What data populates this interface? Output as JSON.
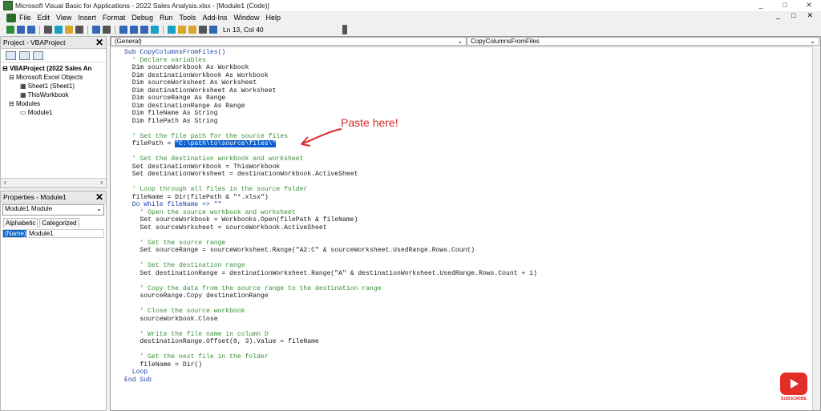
{
  "window": {
    "title": "Microsoft Visual Basic for Applications - 2022 Sales Analysis.xlsx - [Module1 (Code)]",
    "controls": [
      "_",
      "□",
      "✕"
    ]
  },
  "menu": {
    "items": [
      "File",
      "Edit",
      "View",
      "Insert",
      "Format",
      "Debug",
      "Run",
      "Tools",
      "Add-Ins",
      "Window",
      "Help"
    ],
    "mdi_controls": [
      "_",
      "□",
      "✕"
    ]
  },
  "toolbar": {
    "position": "Ln 13, Col 40"
  },
  "project_pane": {
    "title": "Project - VBAProject",
    "tree": [
      {
        "label": "VBAProject (2022 Sales An",
        "level": 0
      },
      {
        "label": "Microsoft Excel Objects",
        "level": 1
      },
      {
        "label": "Sheet1 (Sheet1)",
        "level": 2
      },
      {
        "label": "ThisWorkbook",
        "level": 2
      },
      {
        "label": "Modules",
        "level": 1
      },
      {
        "label": "Module1",
        "level": 2
      }
    ]
  },
  "properties_pane": {
    "title": "Properties - Module1",
    "object": "Module1 Module",
    "tabs": [
      "Alphabetic",
      "Categorized"
    ],
    "name_key": "(Name)",
    "name_value": "Module1"
  },
  "code_window": {
    "object_combo": "(General)",
    "proc_combo": "CopyColumnsFromFiles",
    "lines": [
      {
        "text": "Sub CopyColumnsFromFiles()",
        "kind": "kw"
      },
      {
        "text": "  ' Declare variables",
        "kind": "c"
      },
      {
        "text": "  Dim sourceWorkbook As Workbook",
        "kind": "n"
      },
      {
        "text": "  Dim destinationWorkbook As Workbook",
        "kind": "n"
      },
      {
        "text": "  Dim sourceWorksheet As Worksheet",
        "kind": "n"
      },
      {
        "text": "  Dim destinationWorksheet As Worksheet",
        "kind": "n"
      },
      {
        "text": "  Dim sourceRange As Range",
        "kind": "n"
      },
      {
        "text": "  Dim destinationRange As Range",
        "kind": "n"
      },
      {
        "text": "  Dim fileName As String",
        "kind": "n"
      },
      {
        "text": "  Dim filePath As String",
        "kind": "n"
      },
      {
        "text": "",
        "kind": "n"
      },
      {
        "text": "  ' Set the file path for the source files",
        "kind": "c"
      },
      {
        "text": "  filePath = ",
        "kind": "n",
        "sel": "\"C:\\path\\to\\source\\files\\\""
      },
      {
        "text": "",
        "kind": "n"
      },
      {
        "text": "  ' Set the destination workbook and worksheet",
        "kind": "c"
      },
      {
        "text": "  Set destinationWorkbook = ThisWorkbook",
        "kind": "n"
      },
      {
        "text": "  Set destinationWorksheet = destinationWorkbook.ActiveSheet",
        "kind": "n"
      },
      {
        "text": "",
        "kind": "n"
      },
      {
        "text": "  ' Loop through all files in the source folder",
        "kind": "c"
      },
      {
        "text": "  fileName = Dir(filePath & \"*.xlsx\")",
        "kind": "n"
      },
      {
        "text": "  Do While fileName <> \"\"",
        "kind": "kw"
      },
      {
        "text": "    ' Open the source workbook and worksheet",
        "kind": "c"
      },
      {
        "text": "    Set sourceWorkbook = Workbooks.Open(filePath & fileName)",
        "kind": "n"
      },
      {
        "text": "    Set sourceWorksheet = sourceWorkbook.ActiveSheet",
        "kind": "n"
      },
      {
        "text": "",
        "kind": "n"
      },
      {
        "text": "    ' Set the source range",
        "kind": "c"
      },
      {
        "text": "    Set sourceRange = sourceWorksheet.Range(\"A2:C\" & sourceWorksheet.UsedRange.Rows.Count)",
        "kind": "n"
      },
      {
        "text": "",
        "kind": "n"
      },
      {
        "text": "    ' Set the destination range",
        "kind": "c"
      },
      {
        "text": "    Set destinationRange = destinationWorksheet.Range(\"A\" & destinationWorksheet.UsedRange.Rows.Count + 1)",
        "kind": "n"
      },
      {
        "text": "",
        "kind": "n"
      },
      {
        "text": "    ' Copy the data from the source range to the destination range",
        "kind": "c"
      },
      {
        "text": "    sourceRange.Copy destinationRange",
        "kind": "n"
      },
      {
        "text": "",
        "kind": "n"
      },
      {
        "text": "    ' Close the source workbook",
        "kind": "c"
      },
      {
        "text": "    sourceWorkbook.Close",
        "kind": "n"
      },
      {
        "text": "",
        "kind": "n"
      },
      {
        "text": "    ' Write the file name in column D",
        "kind": "c"
      },
      {
        "text": "    destinationRange.Offset(0, 3).Value = fileName",
        "kind": "n"
      },
      {
        "text": "",
        "kind": "n"
      },
      {
        "text": "    ' Get the next file in the folder",
        "kind": "c"
      },
      {
        "text": "    fileName = Dir()",
        "kind": "n"
      },
      {
        "text": "  Loop",
        "kind": "kw"
      },
      {
        "text": "End Sub",
        "kind": "kw"
      }
    ]
  },
  "annotation": {
    "text": "Paste here!",
    "color": "#d62a2a"
  },
  "subscribe": {
    "label": "SUBSCRIBE",
    "color": "#e52d27"
  }
}
